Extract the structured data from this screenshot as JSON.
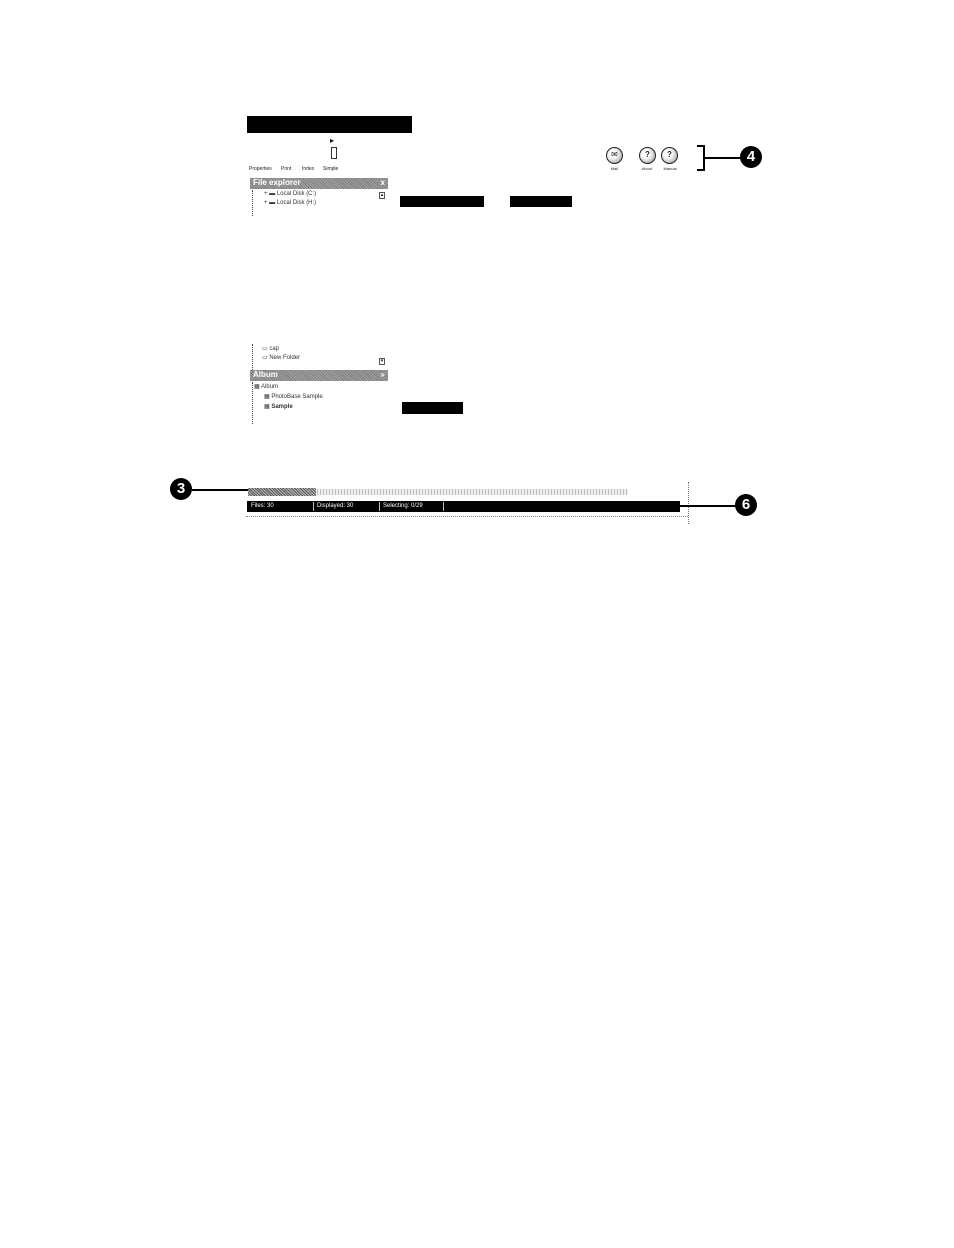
{
  "toolbar": {
    "buttons": [
      {
        "label": "Properties"
      },
      {
        "label": "Print"
      },
      {
        "label": "Index"
      },
      {
        "label": "Simple"
      }
    ]
  },
  "file_explorer": {
    "title": "File explorer",
    "close": "x",
    "drives": [
      "Local Disk (C:)",
      "Local Disk (H:)"
    ],
    "folders": [
      "cap",
      "New Folder"
    ]
  },
  "album": {
    "title": "Album",
    "items": [
      "Album",
      "PhotoBase Sample",
      "Sample"
    ]
  },
  "top_icons": [
    {
      "label": "Mail",
      "icon": "mail-icon"
    },
    {
      "label": "About",
      "icon": "about-icon"
    },
    {
      "label": "Manual",
      "icon": "manual-icon"
    }
  ],
  "status": {
    "files": "Files: 30",
    "displayed": "Displayed: 30",
    "selecting": "Selecting: 0/29"
  },
  "callouts": {
    "three": "3",
    "four": "4",
    "six": "6"
  }
}
